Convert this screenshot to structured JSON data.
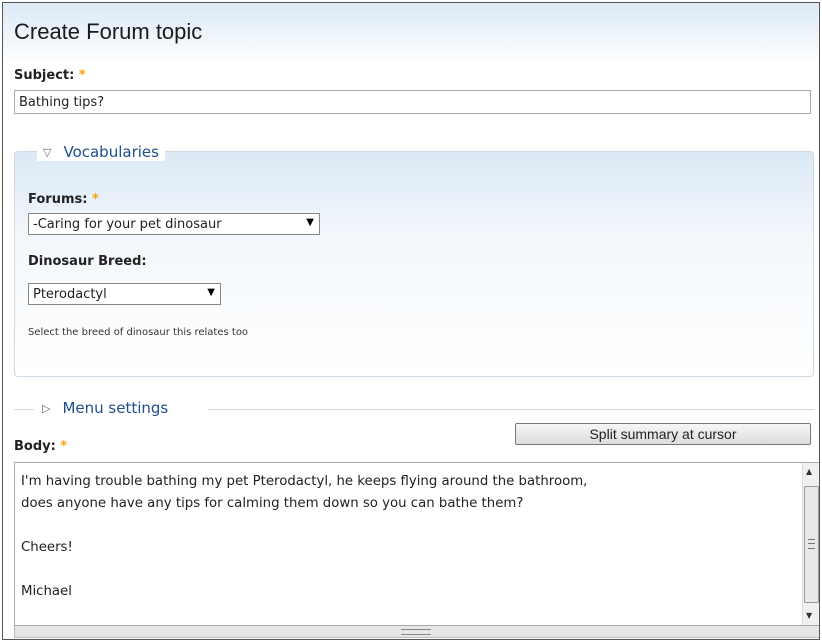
{
  "page_title": "Create Forum topic",
  "subject": {
    "label": "Subject:",
    "required_marker": "*",
    "value": "Bathing tips?"
  },
  "vocabularies": {
    "legend": "Vocabularies",
    "toggle_icon": "triangle-down-icon",
    "forums": {
      "label": "Forums:",
      "required_marker": "*",
      "selected": "-Caring for your pet dinosaur"
    },
    "breed": {
      "label": "Dinosaur Breed:",
      "selected": "Pterodactyl",
      "help": "Select the breed of dinosaur this relates too"
    }
  },
  "menu_settings": {
    "legend": "Menu settings",
    "toggle_icon": "triangle-right-icon"
  },
  "body": {
    "label": "Body:",
    "required_marker": "*",
    "split_button": "Split summary at cursor",
    "text": "I'm having trouble bathing my pet Pterodactyl, he keeps flying around the bathroom,\ndoes anyone have any tips for calming them down so you can bathe them?\n\nCheers!\n\nMichael"
  },
  "colors": {
    "required": "#f7a500",
    "link": "#1f4e8c"
  }
}
